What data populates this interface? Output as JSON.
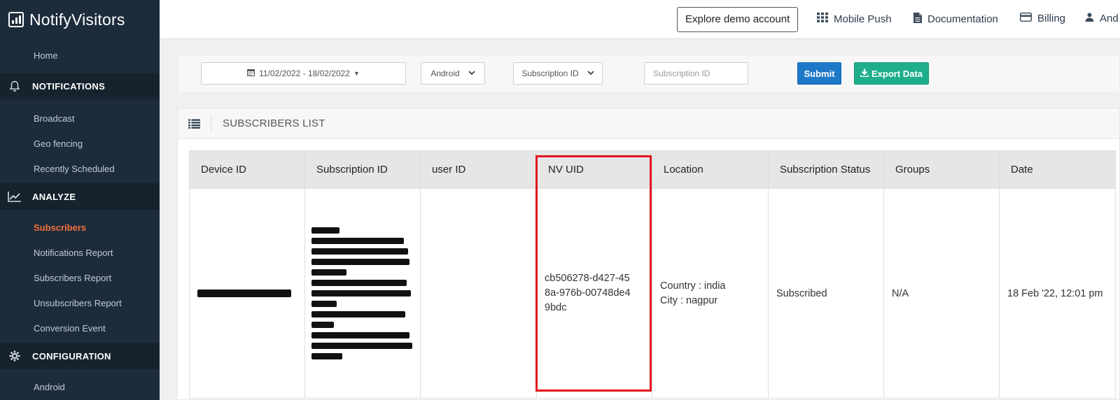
{
  "brand": {
    "name": "NotifyVisitors"
  },
  "header": {
    "demo_button": "Explore demo account",
    "links": [
      {
        "label": "Mobile Push",
        "icon": "grid-icon"
      },
      {
        "label": "Documentation",
        "icon": "document-icon"
      },
      {
        "label": "Billing",
        "icon": "credit-card-icon"
      },
      {
        "label": "And",
        "icon": "user-icon"
      }
    ]
  },
  "sidebar": {
    "home": "Home",
    "notifications": {
      "title": "NOTIFICATIONS",
      "items": [
        "Broadcast",
        "Geo fencing",
        "Recently Scheduled"
      ]
    },
    "analyze": {
      "title": "ANALYZE",
      "items": [
        "Subscribers",
        "Notifications Report",
        "Subscribers Report",
        "Unsubscribers Report",
        "Conversion Event"
      ]
    },
    "configuration": {
      "title": "CONFIGURATION",
      "items": [
        "Android"
      ]
    }
  },
  "filters": {
    "date_range": "11/02/2022 - 18/02/2022",
    "platform": "Android",
    "field": "Subscription ID",
    "search_placeholder": "Subscription ID",
    "submit": "Submit",
    "export": "Export Data"
  },
  "panel": {
    "title": "SUBSCRIBERS LIST"
  },
  "table": {
    "headers": [
      "Device ID",
      "Subscription ID",
      "user ID",
      "NV UID",
      "Location",
      "Subscription Status",
      "Groups",
      "Date"
    ],
    "row": {
      "nv_uid": "cb506278-d427-458a-976b-00748de49bdc",
      "country": "Country : india",
      "city": "City : nagpur",
      "status": "Subscribed",
      "groups": "N/A",
      "date": "18 Feb '22, 12:01 pm"
    }
  },
  "colors": {
    "sidebar": "#1d2c3b",
    "active": "#f36f3a",
    "submit": "#1e79c9",
    "export": "#1fae8c",
    "highlight": "#e4151c"
  }
}
